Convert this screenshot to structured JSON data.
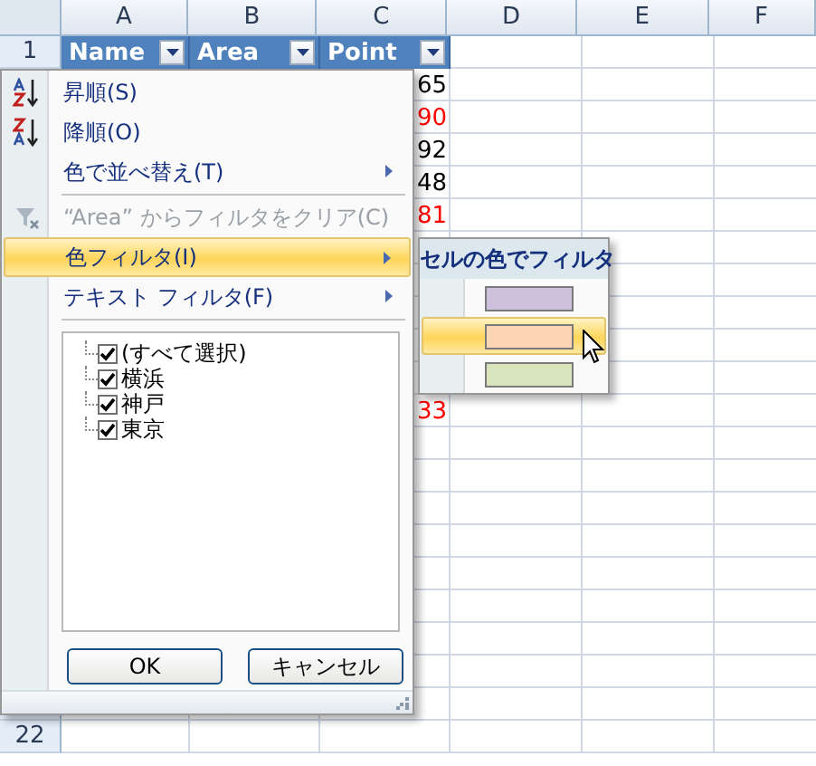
{
  "columns": [
    {
      "label": "A"
    },
    {
      "label": "B"
    },
    {
      "label": "C"
    },
    {
      "label": "D"
    },
    {
      "label": "E"
    },
    {
      "label": "F"
    }
  ],
  "header_row": {
    "number": "1",
    "cells": [
      {
        "text": "Name",
        "filter": true
      },
      {
        "text": "Area",
        "filter": true
      },
      {
        "text": "Point",
        "filter": true
      }
    ]
  },
  "rows": [
    {
      "point": "65",
      "color": "#000000"
    },
    {
      "point": "90",
      "color": "#ff0000"
    },
    {
      "point": "92",
      "color": "#000000"
    },
    {
      "point": "48",
      "color": "#000000"
    },
    {
      "point": "81",
      "color": "#ff0000"
    },
    {},
    {},
    {},
    {},
    {},
    {
      "point": "33",
      "color": "#ff0000"
    },
    {},
    {},
    {},
    {},
    {},
    {},
    {},
    {},
    {},
    {
      "number": "22"
    }
  ],
  "menu": {
    "items": [
      {
        "kind": "sort_ascending",
        "label": "昇順(S)",
        "submenu": false,
        "disabled": false,
        "selected": false
      },
      {
        "kind": "sort_descending",
        "label": "降順(O)",
        "submenu": false,
        "disabled": false,
        "selected": false
      },
      {
        "kind": "item",
        "label": "色で並べ替え(T)",
        "submenu": true,
        "disabled": false,
        "selected": false
      },
      {
        "kind": "separator"
      },
      {
        "kind": "clear_filter",
        "label": "“Area” からフィルタをクリア(C)",
        "submenu": false,
        "disabled": true,
        "selected": false
      },
      {
        "kind": "item",
        "label": "色フィルタ(I)",
        "submenu": true,
        "disabled": false,
        "selected": true
      },
      {
        "kind": "item",
        "label": "テキスト フィルタ(F)",
        "submenu": true,
        "disabled": false,
        "selected": false
      },
      {
        "kind": "separator"
      }
    ],
    "values": [
      {
        "label": "(すべて選択)",
        "checked": true
      },
      {
        "label": "横浜",
        "checked": true
      },
      {
        "label": "神戸",
        "checked": true
      },
      {
        "label": "東京",
        "checked": true
      }
    ],
    "buttons": [
      {
        "label": "OK"
      },
      {
        "label": "キャンセル"
      }
    ]
  },
  "submenu": {
    "title": "セルの色でフィルタ",
    "swatches": [
      {
        "color": "#ccc0da",
        "selected": false
      },
      {
        "color": "#fcd5b4",
        "selected": true
      },
      {
        "color": "#d8e4bc",
        "selected": false
      }
    ]
  }
}
